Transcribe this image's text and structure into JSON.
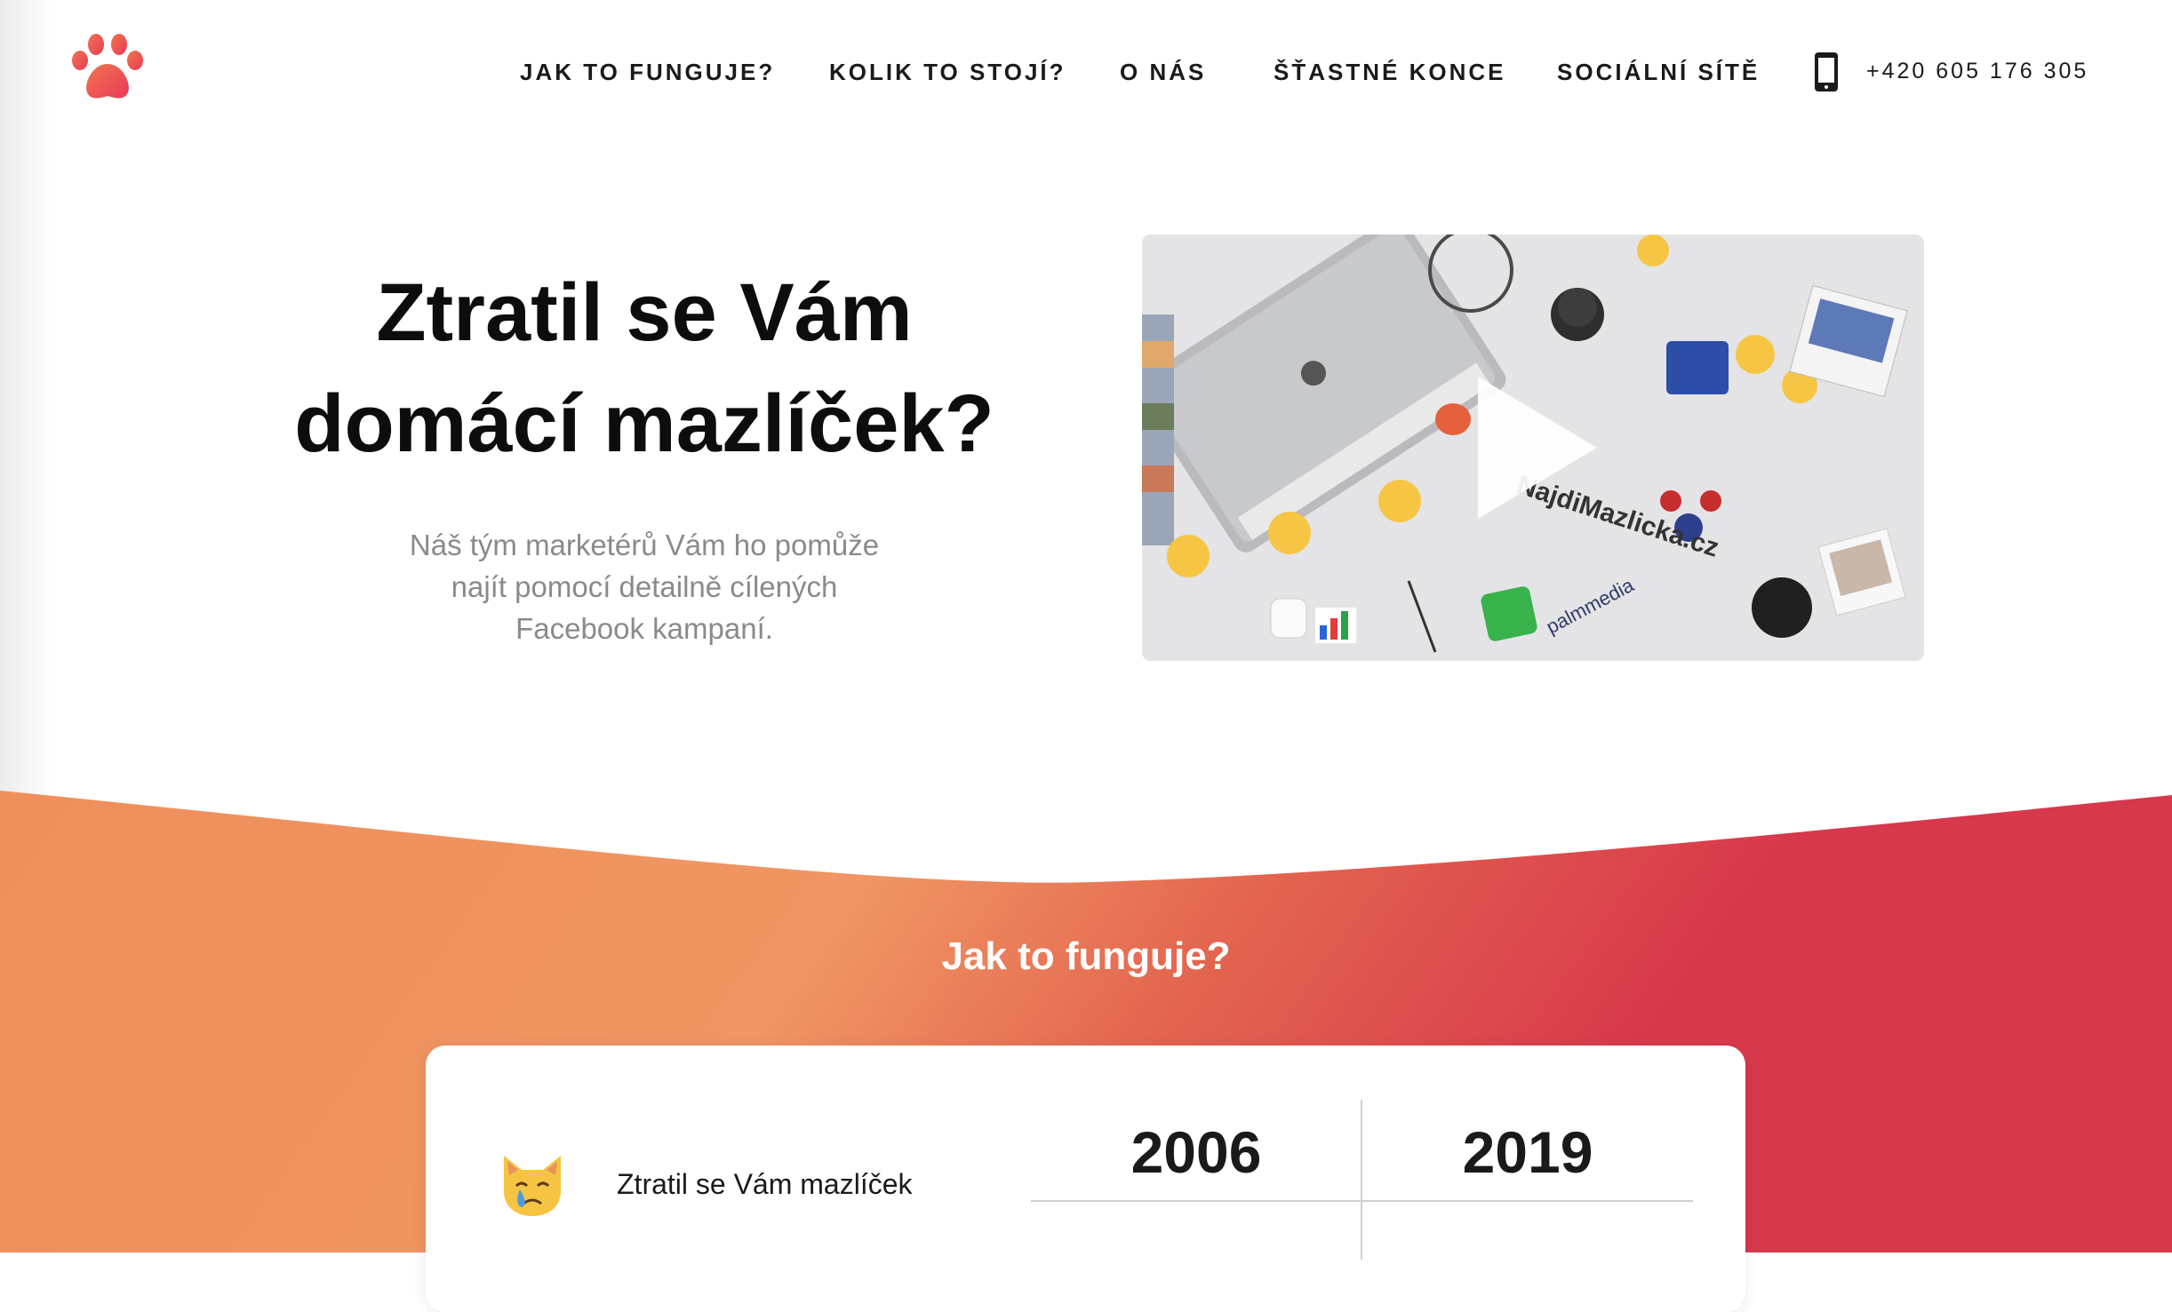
{
  "header": {
    "logo_icon": "paw-icon",
    "nav": [
      {
        "label": "JAK TO FUNGUJE?"
      },
      {
        "label": "KOLIK TO STOJÍ?"
      },
      {
        "label": "O NÁS"
      },
      {
        "label": "ŠŤASTNÉ KONCE"
      },
      {
        "label": "SOCIÁLNÍ SÍTĚ"
      }
    ],
    "phone_icon": "phone-icon",
    "phone": "+420 605 176 305"
  },
  "hero": {
    "title_line1": "Ztratil se Vám",
    "title_line2": "domácí mazlíček?",
    "subtitle_line1": "Náš tým marketérů Vám ho pomůže",
    "subtitle_line2": "najít pomocí detailně cílených",
    "subtitle_line3": "Facebook kampaní.",
    "video": {
      "play_icon": "play-icon",
      "brand_text": "NajdiMazlicka.cz",
      "watermark": "palmmedia"
    }
  },
  "how_it_works": {
    "title": "Jak to funguje?",
    "row_icon": "crying-cat-icon",
    "row_label": "Ztratil se Vám mazlíček",
    "years": [
      "2006",
      "2019"
    ]
  },
  "colors": {
    "gradient_start": "#ef8f5c",
    "gradient_mid": "#f09563",
    "gradient_end": "#d8384c",
    "paw": "#ee4a5a"
  }
}
